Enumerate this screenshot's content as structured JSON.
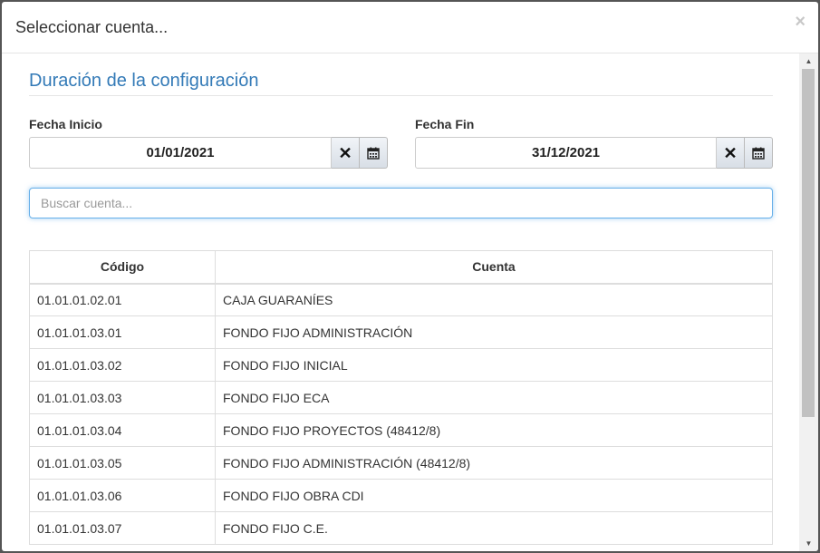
{
  "dialog": {
    "title": "Seleccionar cuenta...",
    "close_label": "×"
  },
  "section": {
    "title": "Duración de la configuración"
  },
  "start_date": {
    "label": "Fecha Inicio",
    "value": "01/01/2021",
    "clear_icon": "x-icon",
    "calendar_icon": "calendar-icon"
  },
  "end_date": {
    "label": "Fecha Fin",
    "value": "31/12/2021",
    "clear_icon": "x-icon",
    "calendar_icon": "calendar-icon"
  },
  "search": {
    "placeholder": "Buscar cuenta...",
    "value": ""
  },
  "table": {
    "headers": [
      "Código",
      "Cuenta"
    ],
    "rows": [
      {
        "code": "01.01.01.02.01",
        "name": "CAJA GUARANÍES"
      },
      {
        "code": "01.01.01.03.01",
        "name": "FONDO FIJO ADMINISTRACIÓN"
      },
      {
        "code": "01.01.01.03.02",
        "name": "FONDO FIJO INICIAL"
      },
      {
        "code": "01.01.01.03.03",
        "name": "FONDO FIJO ECA"
      },
      {
        "code": "01.01.01.03.04",
        "name": "FONDO FIJO PROYECTOS (48412/8)"
      },
      {
        "code": "01.01.01.03.05",
        "name": "FONDO FIJO ADMINISTRACIÓN (48412/8)"
      },
      {
        "code": "01.01.01.03.06",
        "name": "FONDO FIJO OBRA CDI"
      },
      {
        "code": "01.01.01.03.07",
        "name": "FONDO FIJO C.E."
      }
    ]
  },
  "colors": {
    "accent": "#337ab7",
    "focus_border": "#66afe9"
  }
}
